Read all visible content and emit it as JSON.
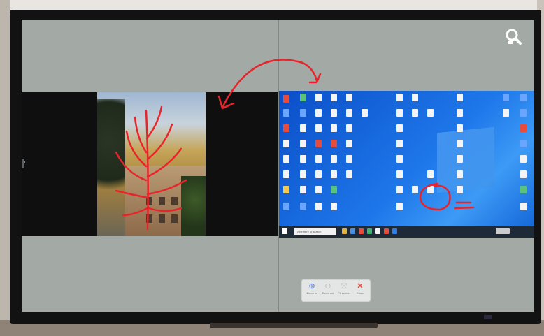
{
  "colors": {
    "screen_bg": "#a3aaa6",
    "annotation_ink": "#e8242a",
    "desktop_blue": "#1e78ea",
    "toolbar_accent": "#4a6fd8",
    "close_red": "#e0443a"
  },
  "icons": {
    "magnifier": "search-magnifier-icon",
    "zoom_in": "plus-magnifier-icon",
    "zoom_out": "minus-magnifier-icon",
    "fit": "fit-screen-icon",
    "close": "close-icon"
  },
  "taskbar": {
    "search_placeholder": "Type here to search"
  },
  "toolbar": {
    "zoom_in_label": "Zoom in",
    "zoom_out_label": "Zoom out",
    "fit_label": "Fit screen",
    "close_label": "Close"
  }
}
